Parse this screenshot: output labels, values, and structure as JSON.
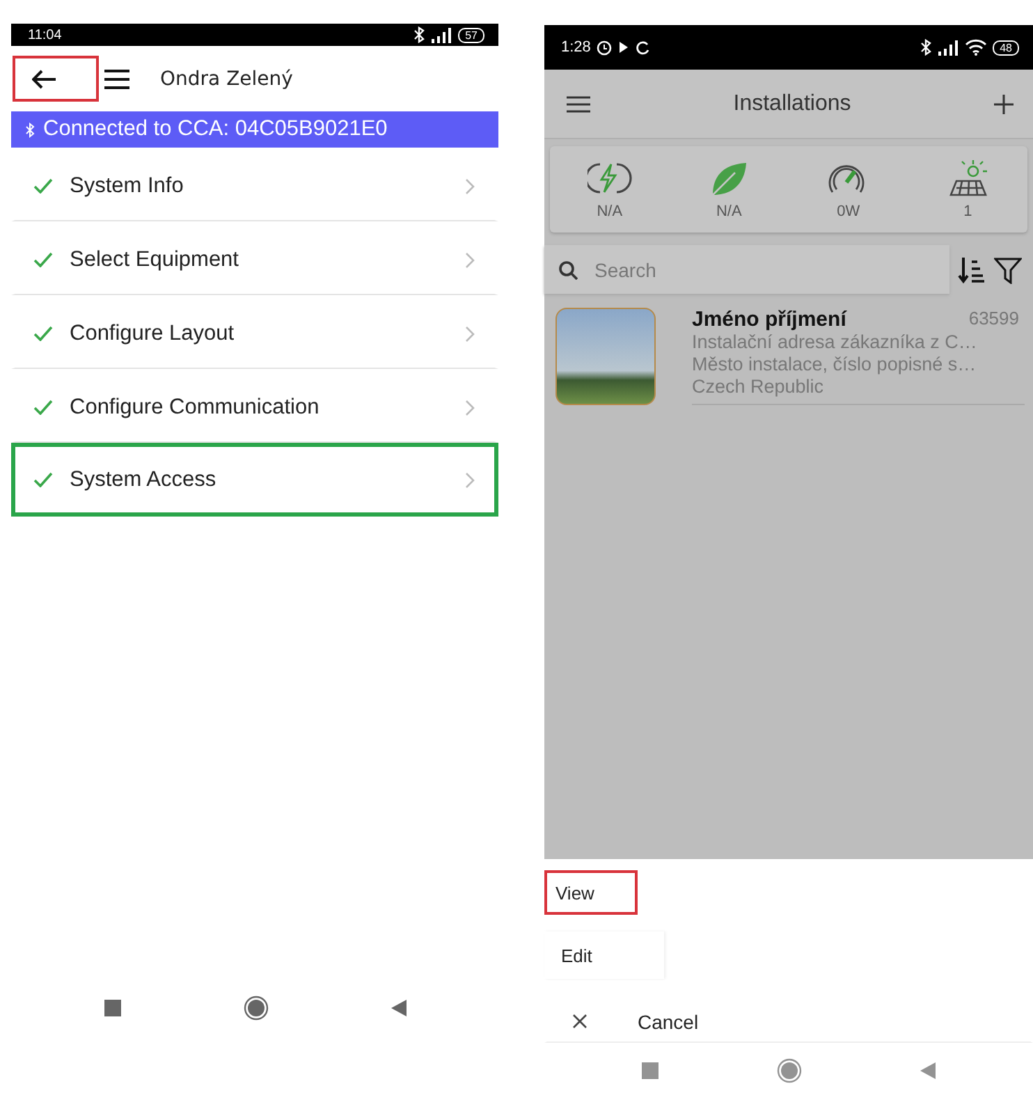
{
  "left_screen": {
    "status_bar": {
      "time": "11:04",
      "battery": "57"
    },
    "header": {
      "back_highlighted": true,
      "title": "Ondra Zelený"
    },
    "connection_banner": {
      "text": "Connected to CCA: 04C05B9021E0"
    },
    "menu_items": [
      {
        "label": "System Info",
        "completed": true,
        "highlighted": false
      },
      {
        "label": "Select Equipment",
        "completed": true,
        "highlighted": false
      },
      {
        "label": "Configure Layout",
        "completed": true,
        "highlighted": false
      },
      {
        "label": "Configure Communication",
        "completed": true,
        "highlighted": false
      },
      {
        "label": "System Access",
        "completed": true,
        "highlighted": true
      }
    ]
  },
  "right_screen": {
    "status_bar": {
      "time": "1:28",
      "battery": "48"
    },
    "header": {
      "title": "Installations"
    },
    "stats": [
      {
        "kind": "energy",
        "value": "N/A"
      },
      {
        "kind": "leaf",
        "value": "N/A"
      },
      {
        "kind": "gauge",
        "value": "0W"
      },
      {
        "kind": "solar",
        "value": "1"
      }
    ],
    "search": {
      "placeholder": "Search"
    },
    "installations": [
      {
        "name": "Jméno příjmení",
        "number": "63599",
        "lines": [
          "Instalační adresa zákazníka z C…",
          "Město instalace, číslo popisné s…",
          "Czech Republic"
        ]
      }
    ],
    "actions": [
      {
        "kind": "option",
        "label": "View",
        "highlighted": true
      },
      {
        "kind": "option",
        "label": "Edit",
        "highlighted": false
      },
      {
        "kind": "cancel",
        "label": "Cancel",
        "highlighted": false
      }
    ]
  }
}
